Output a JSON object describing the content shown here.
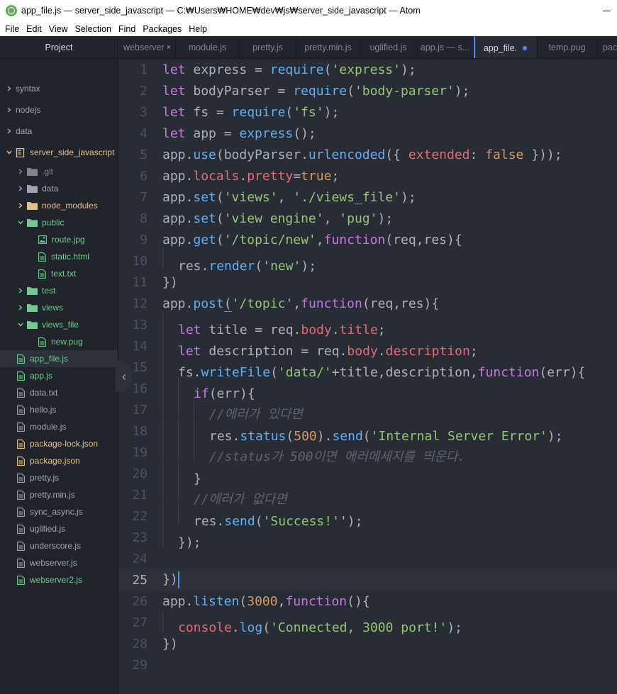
{
  "window": {
    "title": "app_file.js — server_side_javascript — C:₩Users₩HOME₩dev₩js₩server_side_javascript — Atom"
  },
  "menu": [
    "File",
    "Edit",
    "View",
    "Selection",
    "Find",
    "Packages",
    "Help"
  ],
  "sidebar": {
    "title": "Project",
    "collapse_icon": "‹",
    "items": [
      {
        "label": "syntax",
        "kind": "folder",
        "depth": 0,
        "open": false,
        "color": "default"
      },
      {
        "label": "nodejs",
        "kind": "folder",
        "depth": 0,
        "open": false,
        "color": "default"
      },
      {
        "label": "data",
        "kind": "folder",
        "depth": 0,
        "open": false,
        "color": "default"
      },
      {
        "label": "server_side_javascript",
        "kind": "repo",
        "depth": 0,
        "open": true,
        "color": "orange"
      },
      {
        "label": ".git",
        "kind": "folder",
        "depth": 1,
        "open": false,
        "color": "dim"
      },
      {
        "label": "data",
        "kind": "folder",
        "depth": 1,
        "open": false,
        "color": "default"
      },
      {
        "label": "node_modules",
        "kind": "folder",
        "depth": 1,
        "open": false,
        "color": "orange"
      },
      {
        "label": "public",
        "kind": "folder",
        "depth": 1,
        "open": true,
        "color": "green"
      },
      {
        "label": "route.jpg",
        "kind": "image",
        "depth": 2,
        "color": "green"
      },
      {
        "label": "static.html",
        "kind": "file",
        "depth": 2,
        "color": "green"
      },
      {
        "label": "text.txt",
        "kind": "file",
        "depth": 2,
        "color": "green"
      },
      {
        "label": "test",
        "kind": "folder",
        "depth": 1,
        "open": false,
        "color": "green"
      },
      {
        "label": "views",
        "kind": "folder",
        "depth": 1,
        "open": false,
        "color": "green"
      },
      {
        "label": "views_file",
        "kind": "folder",
        "depth": 1,
        "open": true,
        "color": "green"
      },
      {
        "label": "new.pug",
        "kind": "file",
        "depth": 2,
        "color": "green"
      },
      {
        "label": "app_file.js",
        "kind": "file",
        "depth": 1,
        "color": "green",
        "selected": true
      },
      {
        "label": "app.js",
        "kind": "file",
        "depth": 1,
        "color": "green"
      },
      {
        "label": "data.txt",
        "kind": "file",
        "depth": 1,
        "color": "default"
      },
      {
        "label": "hello.js",
        "kind": "file",
        "depth": 1,
        "color": "default"
      },
      {
        "label": "module.js",
        "kind": "file",
        "depth": 1,
        "color": "default"
      },
      {
        "label": "package-lock.json",
        "kind": "file",
        "depth": 1,
        "color": "orange"
      },
      {
        "label": "package.json",
        "kind": "file",
        "depth": 1,
        "color": "orange"
      },
      {
        "label": "pretty.js",
        "kind": "file",
        "depth": 1,
        "color": "default"
      },
      {
        "label": "pretty.min.js",
        "kind": "file",
        "depth": 1,
        "color": "default"
      },
      {
        "label": "sync_async.js",
        "kind": "file",
        "depth": 1,
        "color": "default"
      },
      {
        "label": "uglified.js",
        "kind": "file",
        "depth": 1,
        "color": "default"
      },
      {
        "label": "underscore.js",
        "kind": "file",
        "depth": 1,
        "color": "default"
      },
      {
        "label": "webserver.js",
        "kind": "file",
        "depth": 1,
        "color": "default"
      },
      {
        "label": "webserver2.js",
        "kind": "file",
        "depth": 1,
        "color": "green"
      }
    ]
  },
  "tabs": [
    {
      "label": "webserver",
      "close": "×"
    },
    {
      "label": "module.js"
    },
    {
      "label": "pretty.js"
    },
    {
      "label": "pretty.min.js"
    },
    {
      "label": "uglified.js"
    },
    {
      "label": "app.js — s..."
    },
    {
      "label": "app_file.",
      "active": true,
      "modified": true
    },
    {
      "label": "temp.pug"
    },
    {
      "label": "pack"
    }
  ],
  "editor": {
    "cursor_line": 25,
    "lines": [
      {
        "n": "1",
        "indent": 0,
        "tokens": [
          [
            "kw",
            "let"
          ],
          [
            "plain",
            " express = "
          ],
          [
            "fn",
            "require"
          ],
          [
            "plain",
            "("
          ],
          [
            "str",
            "'express'"
          ],
          [
            "plain",
            ");"
          ]
        ]
      },
      {
        "n": "2",
        "indent": 0,
        "tokens": [
          [
            "kw",
            "let"
          ],
          [
            "plain",
            " bodyParser = "
          ],
          [
            "fn",
            "require"
          ],
          [
            "plain",
            "("
          ],
          [
            "str",
            "'body-parser'"
          ],
          [
            "plain",
            ");"
          ]
        ]
      },
      {
        "n": "3",
        "indent": 0,
        "tokens": [
          [
            "kw",
            "let"
          ],
          [
            "plain",
            " fs = "
          ],
          [
            "fn",
            "require"
          ],
          [
            "plain",
            "("
          ],
          [
            "str",
            "'fs'"
          ],
          [
            "plain",
            ");"
          ]
        ]
      },
      {
        "n": "4",
        "indent": 0,
        "tokens": [
          [
            "kw",
            "let"
          ],
          [
            "plain",
            " app = "
          ],
          [
            "fn",
            "express"
          ],
          [
            "plain",
            "();"
          ]
        ]
      },
      {
        "n": "5",
        "indent": 0,
        "tokens": [
          [
            "plain",
            "app."
          ],
          [
            "fn",
            "use"
          ],
          [
            "plain",
            "(bodyParser."
          ],
          [
            "fn",
            "urlencoded"
          ],
          [
            "plain",
            "({ "
          ],
          [
            "prop",
            "extended"
          ],
          [
            "plain",
            ": "
          ],
          [
            "num",
            "false"
          ],
          [
            "plain",
            " }));"
          ]
        ]
      },
      {
        "n": "6",
        "indent": 0,
        "tokens": [
          [
            "plain",
            "app."
          ],
          [
            "prop",
            "locals"
          ],
          [
            "plain",
            "."
          ],
          [
            "prop",
            "pretty"
          ],
          [
            "plain",
            "="
          ],
          [
            "num",
            "true"
          ],
          [
            "plain",
            ";"
          ]
        ]
      },
      {
        "n": "7",
        "indent": 0,
        "tokens": [
          [
            "plain",
            "app."
          ],
          [
            "fn",
            "set"
          ],
          [
            "plain",
            "("
          ],
          [
            "str",
            "'views'"
          ],
          [
            "plain",
            ", "
          ],
          [
            "str",
            "'./views_file'"
          ],
          [
            "plain",
            ");"
          ]
        ]
      },
      {
        "n": "8",
        "indent": 0,
        "tokens": [
          [
            "plain",
            "app."
          ],
          [
            "fn",
            "set"
          ],
          [
            "plain",
            "("
          ],
          [
            "str",
            "'view engine'"
          ],
          [
            "plain",
            ", "
          ],
          [
            "str",
            "'pug'"
          ],
          [
            "plain",
            ");"
          ]
        ]
      },
      {
        "n": "9",
        "indent": 0,
        "tokens": [
          [
            "plain",
            "app."
          ],
          [
            "fn",
            "get"
          ],
          [
            "plain",
            "("
          ],
          [
            "str",
            "'/topic/new'"
          ],
          [
            "plain",
            ","
          ],
          [
            "kw",
            "function"
          ],
          [
            "plain",
            "(req,res){"
          ]
        ]
      },
      {
        "n": "10",
        "indent": 1,
        "tokens": [
          [
            "plain",
            "res."
          ],
          [
            "fn",
            "render"
          ],
          [
            "plain",
            "("
          ],
          [
            "str",
            "'new'"
          ],
          [
            "plain",
            ");"
          ]
        ]
      },
      {
        "n": "11",
        "indent": 0,
        "tokens": [
          [
            "plain",
            "})"
          ]
        ]
      },
      {
        "n": "12",
        "indent": 0,
        "tokens": [
          [
            "plain",
            "app."
          ],
          [
            "fn",
            "post"
          ],
          [
            "bracket",
            "("
          ],
          [
            "str",
            "'/topic'"
          ],
          [
            "plain",
            ","
          ],
          [
            "kw",
            "function"
          ],
          [
            "plain",
            "(req,res){"
          ]
        ]
      },
      {
        "n": "13",
        "indent": 1,
        "tokens": [
          [
            "kw",
            "let"
          ],
          [
            "plain",
            " title = req."
          ],
          [
            "prop",
            "body"
          ],
          [
            "plain",
            "."
          ],
          [
            "prop",
            "title"
          ],
          [
            "plain",
            ";"
          ]
        ]
      },
      {
        "n": "14",
        "indent": 1,
        "tokens": [
          [
            "kw",
            "let"
          ],
          [
            "plain",
            " description = req."
          ],
          [
            "prop",
            "body"
          ],
          [
            "plain",
            "."
          ],
          [
            "prop",
            "description"
          ],
          [
            "plain",
            ";"
          ]
        ]
      },
      {
        "n": "15",
        "indent": 1,
        "tokens": [
          [
            "plain",
            "fs."
          ],
          [
            "fn",
            "writeFile"
          ],
          [
            "plain",
            "("
          ],
          [
            "str",
            "'data/'"
          ],
          [
            "plain",
            "+title,description,"
          ],
          [
            "kw",
            "function"
          ],
          [
            "plain",
            "(err){"
          ]
        ]
      },
      {
        "n": "16",
        "indent": 2,
        "tokens": [
          [
            "kw",
            "if"
          ],
          [
            "plain",
            "(err){"
          ]
        ]
      },
      {
        "n": "17",
        "indent": 3,
        "tokens": [
          [
            "cmt",
            "//에러가 있다면"
          ]
        ]
      },
      {
        "n": "18",
        "indent": 3,
        "tokens": [
          [
            "plain",
            "res."
          ],
          [
            "fn",
            "status"
          ],
          [
            "plain",
            "("
          ],
          [
            "num",
            "500"
          ],
          [
            "plain",
            ")."
          ],
          [
            "fn",
            "send"
          ],
          [
            "plain",
            "("
          ],
          [
            "str",
            "'Internal Server Error'"
          ],
          [
            "plain",
            ");"
          ]
        ]
      },
      {
        "n": "19",
        "indent": 3,
        "tokens": [
          [
            "cmt",
            "//status가 500이면 에러메세지를 띄운다."
          ]
        ]
      },
      {
        "n": "20",
        "indent": 2,
        "tokens": [
          [
            "plain",
            "}"
          ]
        ]
      },
      {
        "n": "21",
        "indent": 2,
        "tokens": [
          [
            "cmt",
            "//에러가 없다면"
          ]
        ]
      },
      {
        "n": "22",
        "indent": 2,
        "tokens": [
          [
            "plain",
            "res."
          ],
          [
            "fn",
            "send"
          ],
          [
            "plain",
            "("
          ],
          [
            "str",
            "'Success!'"
          ],
          [
            "plain",
            "');"
          ]
        ]
      },
      {
        "n": "23",
        "indent": 1,
        "tokens": [
          [
            "plain",
            "});"
          ]
        ]
      },
      {
        "n": "24",
        "indent": 0,
        "tokens": []
      },
      {
        "n": "25",
        "indent": 0,
        "tokens": [
          [
            "plain",
            "})"
          ],
          [
            "caret",
            ""
          ]
        ]
      },
      {
        "n": "26",
        "indent": 0,
        "tokens": [
          [
            "plain",
            "app."
          ],
          [
            "fn",
            "listen"
          ],
          [
            "plain",
            "("
          ],
          [
            "num",
            "3000"
          ],
          [
            "plain",
            ","
          ],
          [
            "kw",
            "function"
          ],
          [
            "plain",
            "(){"
          ]
        ]
      },
      {
        "n": "27",
        "indent": 1,
        "tokens": [
          [
            "prop",
            "console"
          ],
          [
            "plain",
            "."
          ],
          [
            "fn",
            "log"
          ],
          [
            "plain",
            "("
          ],
          [
            "str",
            "'Connected, 3000 port!'"
          ],
          [
            "plain",
            ");"
          ]
        ]
      },
      {
        "n": "28",
        "indent": 0,
        "tokens": [
          [
            "plain",
            "})"
          ]
        ]
      },
      {
        "n": "29",
        "indent": 0,
        "tokens": []
      }
    ]
  },
  "colors": {
    "green": "#73c990",
    "orange": "#e2c08d",
    "default": "#9da5b4",
    "dim": "#7f8693",
    "accent": "#568af2"
  }
}
